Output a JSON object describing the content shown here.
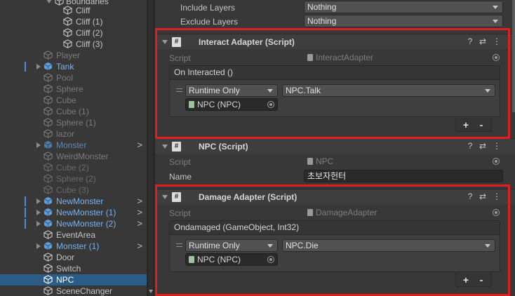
{
  "hierarchy": {
    "items": [
      {
        "label": "Boundaries",
        "color": "normal"
      },
      {
        "label": "Cliff",
        "color": "normal"
      },
      {
        "label": "Cliff (1)",
        "color": "normal"
      },
      {
        "label": "Cliff (2)",
        "color": "normal"
      },
      {
        "label": "Cliff (3)",
        "color": "normal"
      },
      {
        "label": "Player",
        "color": "dim"
      },
      {
        "label": "Tank",
        "color": "prefab"
      },
      {
        "label": "Pool",
        "color": "dim"
      },
      {
        "label": "Sphere",
        "color": "dim"
      },
      {
        "label": "Cube",
        "color": "dim"
      },
      {
        "label": "Cube (1)",
        "color": "dim"
      },
      {
        "label": "Sphere (1)",
        "color": "dim"
      },
      {
        "label": "lazor",
        "color": "dim"
      },
      {
        "label": "Monster",
        "color": "prefab-dim"
      },
      {
        "label": "WeirdMonster",
        "color": "dim"
      },
      {
        "label": "Cube (2)",
        "color": "dim"
      },
      {
        "label": "Sphere (2)",
        "color": "dim"
      },
      {
        "label": "Cube (3)",
        "color": "dim"
      },
      {
        "label": "NewMonster",
        "color": "prefab"
      },
      {
        "label": "NewMonster (1)",
        "color": "prefab"
      },
      {
        "label": "NewMonster (2)",
        "color": "prefab"
      },
      {
        "label": "EventArea",
        "color": "normal"
      },
      {
        "label": "Monster (1)",
        "color": "prefab"
      },
      {
        "label": "Door",
        "color": "normal"
      },
      {
        "label": "Switch",
        "color": "normal"
      },
      {
        "label": "NPC",
        "color": "white"
      },
      {
        "label": "SceneChanger",
        "color": "normal"
      }
    ],
    "chevron": ">"
  },
  "inspector": {
    "include_layers": {
      "label": "Include Layers",
      "value": "Nothing"
    },
    "exclude_layers": {
      "label": "Exclude Layers",
      "value": "Nothing"
    },
    "interact_adapter": {
      "title": "Interact Adapter (Script)",
      "script_label": "Script",
      "script_value": "InteractAdapter",
      "event_title": "On Interacted ()",
      "mode": "Runtime Only",
      "function": "NPC.Talk",
      "target": "NPC (NPC)"
    },
    "npc_script": {
      "title": "NPC (Script)",
      "script_label": "Script",
      "script_value": "NPC",
      "name_label": "Name",
      "name_value": "초보자헌터"
    },
    "damage_adapter": {
      "title": "Damage Adapter (Script)",
      "script_label": "Script",
      "script_value": "DamageAdapter",
      "event_title": "Ondamaged (GameObject, Int32)",
      "mode": "Runtime Only",
      "function": "NPC.Die",
      "target": "NPC (NPC)"
    },
    "plus": "+",
    "minus": "-",
    "script_icon": "#"
  },
  "colors": {
    "highlight": "#dd1f1f",
    "selection": "#2c5d87",
    "prefab_text": "#7bb2ec"
  }
}
